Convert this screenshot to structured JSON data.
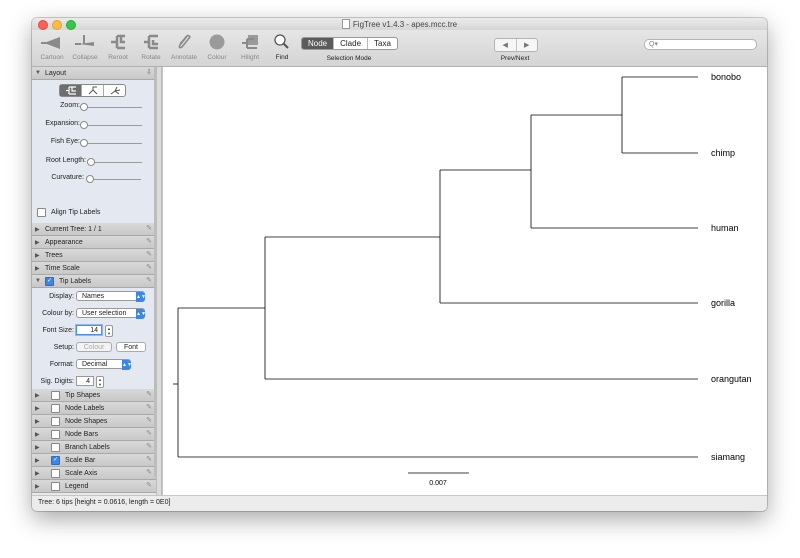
{
  "window": {
    "title": "FigTree v1.4.3 - apes.mcc.tre"
  },
  "toolbar": {
    "tools": [
      {
        "label": "Cartoon",
        "icon": "cartoon-icon"
      },
      {
        "label": "Collapse",
        "icon": "collapse-icon"
      },
      {
        "label": "Reroot",
        "icon": "reroot-icon"
      },
      {
        "label": "Rotate",
        "icon": "rotate-icon"
      },
      {
        "label": "Annotate",
        "icon": "annotate-icon"
      },
      {
        "label": "Colour",
        "icon": "colour-icon"
      },
      {
        "label": "Hilight",
        "icon": "hilight-icon"
      },
      {
        "label": "Find",
        "icon": "find-icon"
      }
    ],
    "selection_mode": {
      "label": "Selection Mode",
      "options": [
        "Node",
        "Clade",
        "Taxa"
      ],
      "selected": "Node"
    },
    "prevnext": {
      "label": "Prev/Next",
      "prev": "◀",
      "next": "▶"
    },
    "search": {
      "placeholder": "Q▾"
    }
  },
  "sidebar": {
    "layout": {
      "title": "Layout",
      "zoom_label": "Zoom:",
      "expansion_label": "Expansion:",
      "fisheye_label": "Fish Eye:",
      "rootlength_label": "Root Length:",
      "curvature_label": "Curvature:",
      "align_label": "Align Tip Labels"
    },
    "collapsed_panels": [
      "Current Tree: 1 / 1",
      "Appearance",
      "Trees",
      "Time Scale"
    ],
    "tip_labels": {
      "title": "Tip Labels",
      "checked": true,
      "display_label": "Display:",
      "display_value": "Names",
      "colourby_label": "Colour by:",
      "colourby_value": "User selection",
      "fontsize_label": "Font Size:",
      "fontsize_value": "14",
      "setup_label": "Setup:",
      "colour_button": "Colour",
      "font_button": "Font",
      "format_label": "Format:",
      "format_value": "Decimal",
      "sigdigits_label": "Sig. Digits:",
      "sigdigits_value": "4"
    },
    "option_panels": [
      {
        "label": "Tip Shapes",
        "checked": false
      },
      {
        "label": "Node Labels",
        "checked": false
      },
      {
        "label": "Node Shapes",
        "checked": false
      },
      {
        "label": "Node Bars",
        "checked": false
      },
      {
        "label": "Branch Labels",
        "checked": false
      },
      {
        "label": "Scale Bar",
        "checked": true
      },
      {
        "label": "Scale Axis",
        "checked": false
      },
      {
        "label": "Legend",
        "checked": false
      }
    ]
  },
  "tree": {
    "tips": [
      "bonobo",
      "chimp",
      "human",
      "gorilla",
      "orangutan",
      "siamang"
    ],
    "scale_label": "0.007"
  },
  "status": {
    "text": "Tree: 6 tips [height = 0.0616, length = 0E0]"
  }
}
